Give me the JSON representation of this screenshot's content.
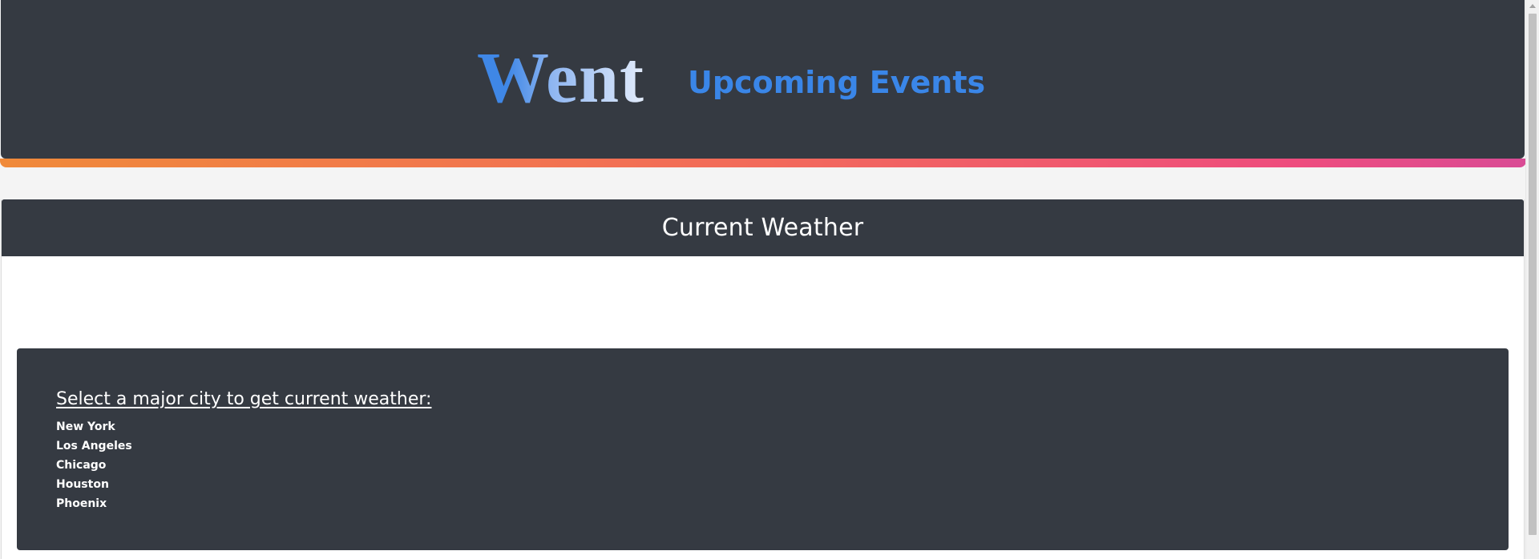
{
  "header": {
    "brand": "Went",
    "nav_link": "Upcoming Events"
  },
  "weather": {
    "title": "Current Weather",
    "prompt": "Select a major city to get current weather:",
    "cities": [
      "New York",
      "Los Angeles",
      "Chicago",
      "Houston",
      "Phoenix"
    ]
  },
  "colors": {
    "header_bg": "#353a42",
    "brand_blue": "#3a86e8",
    "accent_start": "#f08a3a",
    "accent_end": "#d94b95",
    "page_bg": "#f4f4f4"
  }
}
